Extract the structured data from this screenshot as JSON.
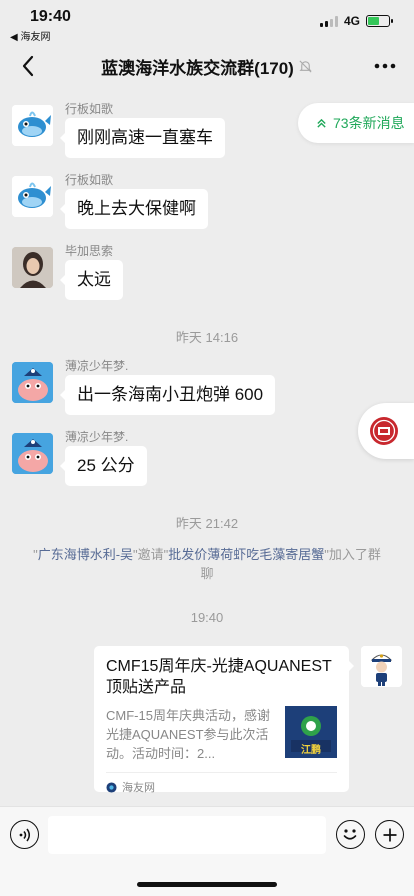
{
  "status": {
    "time": "19:40",
    "back_app": "◀ 海友网",
    "network": "4G"
  },
  "nav": {
    "title": "蓝澳海洋水族交流群(170)",
    "muted_icon": "mute-bell-icon"
  },
  "new_messages": "73条新消息",
  "messages": [
    {
      "sender": "行板如歌",
      "text": "刚刚高速一直塞车"
    },
    {
      "sender": "行板如歌",
      "text": "晚上去大保健啊"
    },
    {
      "sender": "毕加思索",
      "text": "太远"
    },
    {
      "sender": "薄凉少年梦.",
      "text": "出一条海南小丑炮弹 600"
    },
    {
      "sender": "薄凉少年梦.",
      "text": "25 公分"
    }
  ],
  "times": [
    "昨天 14:16",
    "昨天 21:42",
    "19:40"
  ],
  "system_message": {
    "q1": "\"",
    "inviter": "广东海博水利-吴",
    "mid": "\"邀请\"",
    "invitee": "批发价薄荷虾吃毛藻寄居蟹",
    "tail": "\"加入了群聊"
  },
  "card": {
    "title": "CMF15周年庆-光捷AQUANEST顶贴送产品",
    "desc": "CMF-15周年庆典活动，感谢光捷AQUANEST参与此次活动。活动时间：2...",
    "source": "海友网",
    "thumb_label": "江鹏"
  },
  "input": {
    "placeholder": ""
  }
}
